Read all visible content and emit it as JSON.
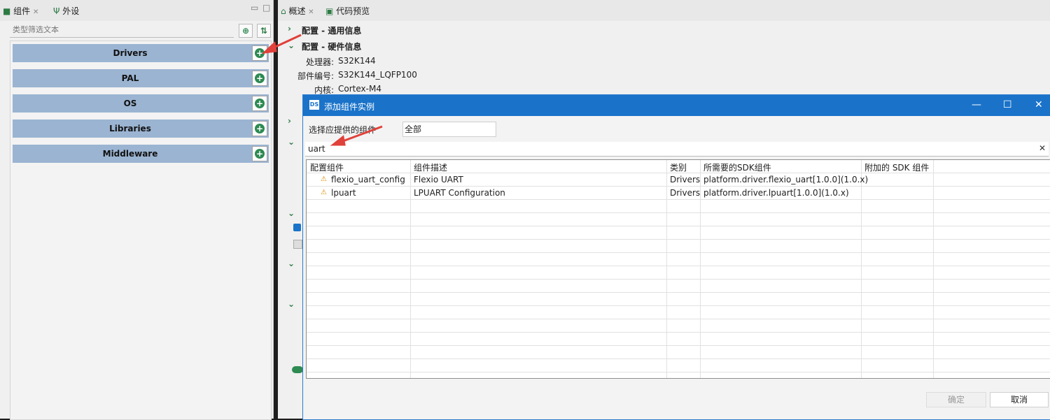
{
  "left_panel": {
    "tab_components": "组件",
    "tab_peripherals": "外设",
    "filter_placeholder": "类型筛选文本",
    "categories": [
      "Drivers",
      "PAL",
      "OS",
      "Libraries",
      "Middleware"
    ]
  },
  "right_panel": {
    "tab_overview": "概述",
    "tab_code_preview": "代码预览",
    "section_general": "配置 - 通用信息",
    "section_hardware": "配置 - 硬件信息",
    "processor_label": "处理器:",
    "processor_value": "S32K144",
    "part_label": "部件编号:",
    "part_value": "S32K144_LQFP100",
    "core_label": "内核:",
    "core_value": "Cortex-M4"
  },
  "dialog": {
    "title": "添加组件实例",
    "filter_label": "选择应提供的组件",
    "filter_value": "全部",
    "search_value": "uart",
    "columns": [
      "配置组件",
      "组件描述",
      "类别",
      "所需要的SDK组件",
      "附加的 SDK 组件"
    ],
    "rows": [
      {
        "name": "flexio_uart_config",
        "desc": "Flexio UART",
        "category": "Drivers",
        "sdk": "platform.driver.flexio_uart[1.0.0](1.0.x)",
        "extra": ""
      },
      {
        "name": "lpuart",
        "desc": "LPUART Configuration",
        "category": "Drivers",
        "sdk": "platform.driver.lpuart[1.0.0](1.0.x)",
        "extra": ""
      }
    ],
    "ok_label": "确定",
    "cancel_label": "取消"
  },
  "colors": {
    "category_bar": "#9bb4d2",
    "accent_green": "#2d8a52",
    "dialog_title_bar": "#1a73c9",
    "annotation_arrow": "#e0413a"
  }
}
